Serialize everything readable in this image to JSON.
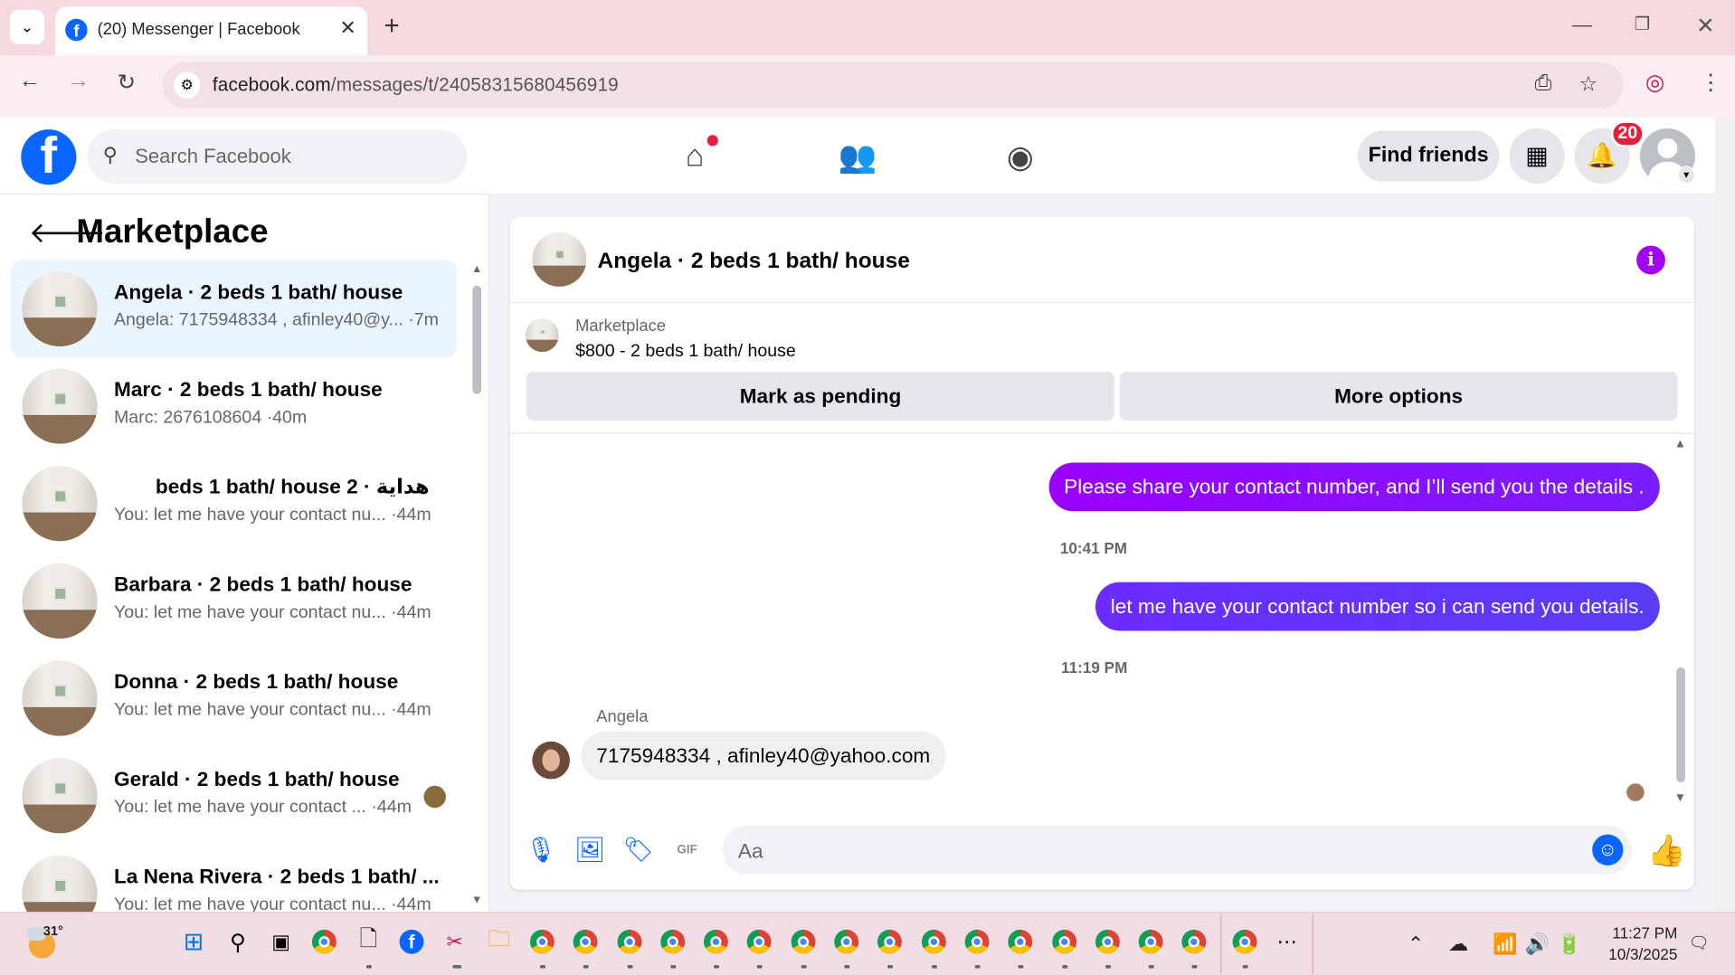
{
  "browser": {
    "tab_title": "(20) Messenger | Facebook",
    "url_host": "facebook.com",
    "url_path": "/messages/t/24058315680456919"
  },
  "header": {
    "search_placeholder": "Search Facebook",
    "find_friends_label": "Find friends",
    "notification_count": "20"
  },
  "sidebar": {
    "title": "Marketplace",
    "threads": [
      {
        "name": "Angela · 2 beds 1 bath/ house",
        "preview": "Angela: 7175948334 , afinley40@y... ·7m"
      },
      {
        "name": "Marc · 2 beds 1 bath/ house",
        "preview": "Marc: 2676108604 ·40m"
      },
      {
        "name": "هداية · 2 beds 1 bath/ house",
        "preview": "You: let me have your contact nu...  ·44m"
      },
      {
        "name": "Barbara · 2 beds 1 bath/ house",
        "preview": "You: let me have your contact nu...  ·44m"
      },
      {
        "name": "Donna · 2 beds 1 bath/ house",
        "preview": "You: let me have your contact nu...  ·44m"
      },
      {
        "name": "Gerald · 2 beds 1 bath/ house",
        "preview": "You: let me have your contact ...  ·44m"
      },
      {
        "name": "La Nena Rivera · 2 beds 1 bath/ ...",
        "preview": "You: let me have your contact nu...  ·44m"
      }
    ]
  },
  "chat": {
    "title": "Angela · 2 beds 1 bath/ house",
    "marketplace_label": "Marketplace",
    "listing": "$800 - 2 beds 1 bath/ house",
    "mark_pending_label": "Mark as pending",
    "more_options_label": "More options",
    "messages": [
      {
        "text": "Please share your contact number, and I’ll send you the details ."
      },
      {
        "time": "10:41 PM"
      },
      {
        "text": "let me have your contact number so i can send you details."
      },
      {
        "time": "11:19 PM"
      },
      {
        "sender": "Angela",
        "text": "7175948334 , afinley40@yahoo.com"
      }
    ],
    "composer_placeholder": "Aa"
  },
  "taskbar": {
    "temperature": "31°",
    "time": "11:27 PM",
    "date": "10/3/2025"
  },
  "colors": {
    "facebook_blue": "#0866ff",
    "outgoing_bubble": "#8a0bff",
    "notification_red": "#e41e3f",
    "active_thread": "#ebf5ff"
  }
}
